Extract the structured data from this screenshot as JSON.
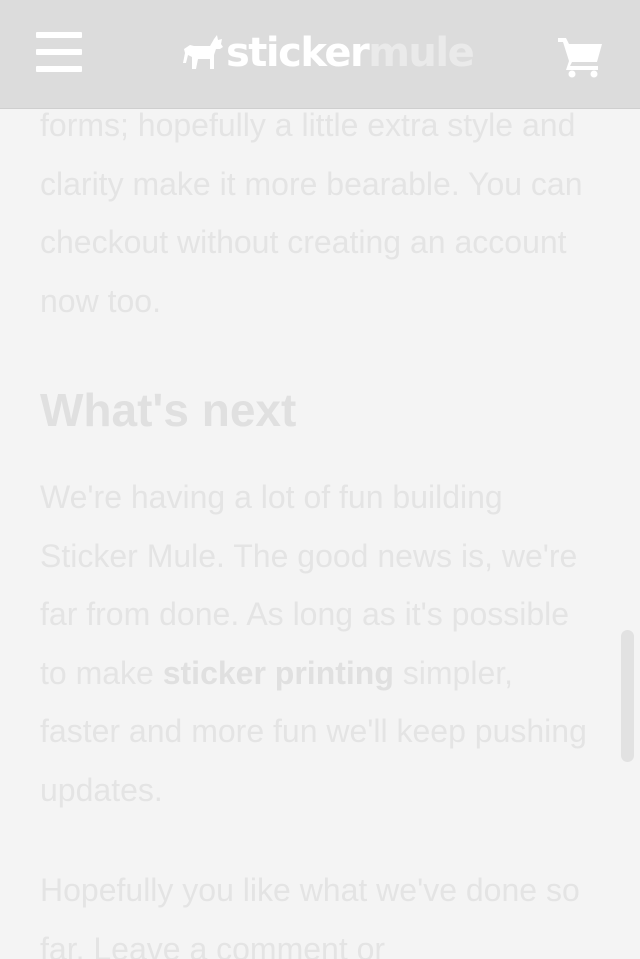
{
  "header": {
    "logo_primary": "sticker",
    "logo_secondary": "mule",
    "icons": {
      "menu": "hamburger-menu-icon",
      "cart": "shopping-cart-icon",
      "logo_mark": "mule-logo-icon"
    }
  },
  "article": {
    "paragraph_1": "forms; hopefully a little extra style and clarity make it more bearable. You can checkout without creating an account now too.",
    "heading": "What's next",
    "paragraph_2_before": "We're having a lot of fun building Sticker Mule. The good news is, we're far from done. As long as it's possible to make ",
    "paragraph_2_link": "sticker printing",
    "paragraph_2_after": " simpler, faster and more fun we'll keep pushing updates.",
    "paragraph_3": "Hopefully you like what we've done so far. Leave a comment or"
  },
  "colors": {
    "header_bg": "#dcdcdc",
    "page_bg": "#f4f4f4",
    "text": "#e4e4e4"
  }
}
